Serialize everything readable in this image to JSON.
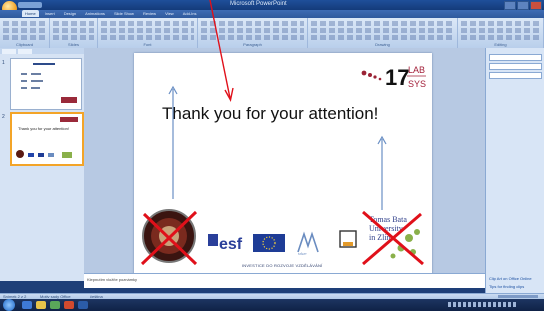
{
  "window": {
    "title": "Microsoft PowerPoint"
  },
  "ribbon": {
    "tabs": [
      "Home",
      "Insert",
      "Design",
      "Animations",
      "Slide Show",
      "Review",
      "View",
      "Add-Ins"
    ],
    "active_tab": 0,
    "groups": [
      "Clipboard",
      "Slides",
      "Font",
      "Paragraph",
      "Drawing",
      "Editing"
    ]
  },
  "slides_panel": {
    "tabs": [
      "Slides",
      "Outline"
    ],
    "slides": [
      {
        "number": "1"
      },
      {
        "number": "2",
        "text": "Thank you for your attention!"
      }
    ]
  },
  "slide": {
    "title": "Thank you for your attention!",
    "lab_logo": "LAB SYS",
    "footer": "INVESTICE DO ROZVOJE VZDĚLÁVÁNÍ",
    "logos": [
      "university-seal-logo",
      "esf-logo",
      "eu-flag-logo",
      "msmt-logo",
      "op-vk-logo",
      "university-dots-logo"
    ]
  },
  "notes": {
    "text": "Klepnutím vložíte poznámky"
  },
  "right_pane": {
    "title": "",
    "links": [
      "Clip Art on Office Online",
      "Tips for finding clips"
    ]
  },
  "statusbar": {
    "left": "Snímek 2 z 2",
    "theme": "Motiv sady Office",
    "language": "čeština"
  },
  "colors": {
    "annotation_red": "#e0101a",
    "annotation_arrow": "#6a8fc4",
    "ribbon": "#dce8f7"
  }
}
